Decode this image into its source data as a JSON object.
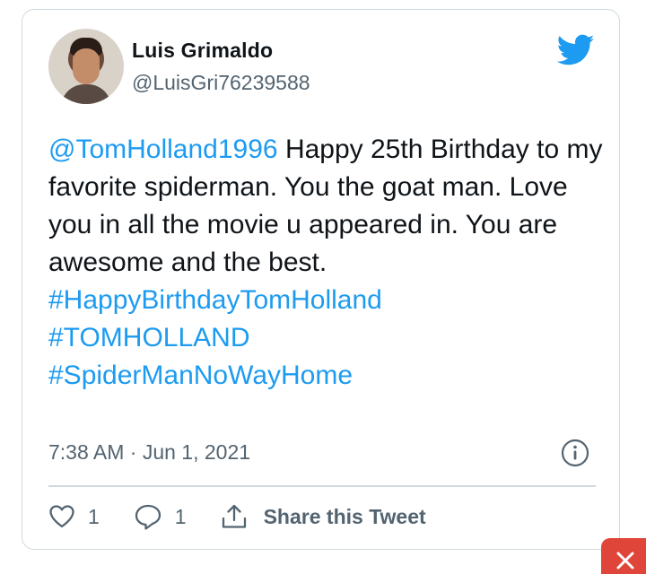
{
  "tweet": {
    "author_name": "Luis Grimaldo",
    "author_handle": "@LuisGri76239588",
    "mention": "@TomHolland1996",
    "body": " Happy 25th Birthday to my favorite spiderman. You the goat man. Love you in all the movie u appeared in. You are awesome and the best.",
    "hashtags": [
      "#HappyBirthdayTomHolland",
      "#TOMHOLLAND",
      "#SpiderManNoWayHome"
    ],
    "timestamp": "7:38 AM · Jun 1, 2021"
  },
  "actions": {
    "likes": "1",
    "replies": "1",
    "share_label": "Share this Tweet"
  },
  "icons": {
    "brand": "twitter-bird-icon",
    "info": "info-icon",
    "like": "heart-icon",
    "reply": "reply-bubble-icon",
    "share": "share-upload-icon",
    "close": "close-icon"
  },
  "colors": {
    "accent": "#1d9bf0",
    "text": "#0f1419",
    "secondary": "#536471",
    "border": "#cfd9de",
    "close_badge": "#e0453a"
  }
}
